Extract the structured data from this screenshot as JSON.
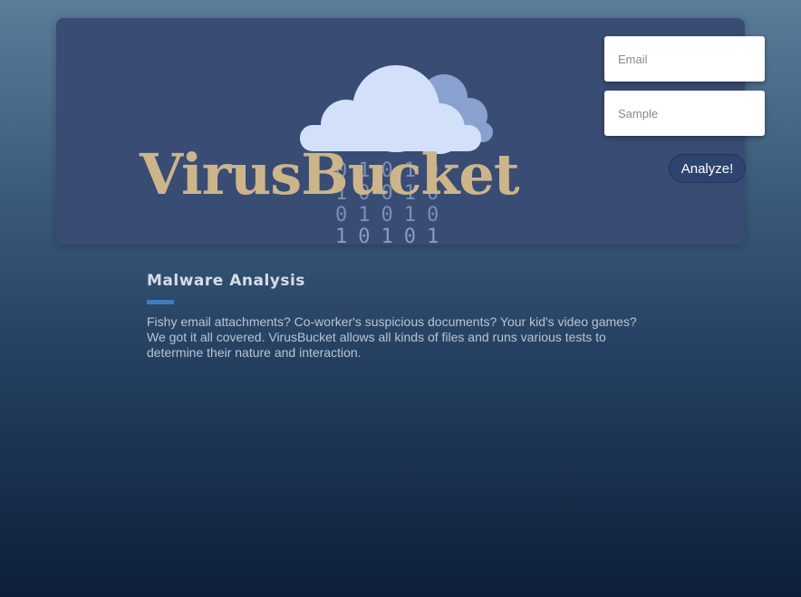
{
  "brand": {
    "name": "VirusBucket",
    "binary_rows": [
      "01010",
      "10010",
      "01010",
      "10101"
    ]
  },
  "form": {
    "email_placeholder": "Email",
    "sample_placeholder": "Sample",
    "submit_label": "Analyze!"
  },
  "section": {
    "title": "Malware Analysis",
    "body": "Fishy email attachments? Co-worker's suspicious documents? Your kid's video games? We got it all covered. VirusBucket allows all kinds of files and runs various tests to determine their nature and interaction."
  },
  "colors": {
    "hero_bg": "#394c73",
    "logo_text": "#cdb58a",
    "cloud_front": "#d3e0fa",
    "cloud_back": "#8aa1cf",
    "accent_bar": "#3b7dbf",
    "button_bg": "#2e4470"
  }
}
